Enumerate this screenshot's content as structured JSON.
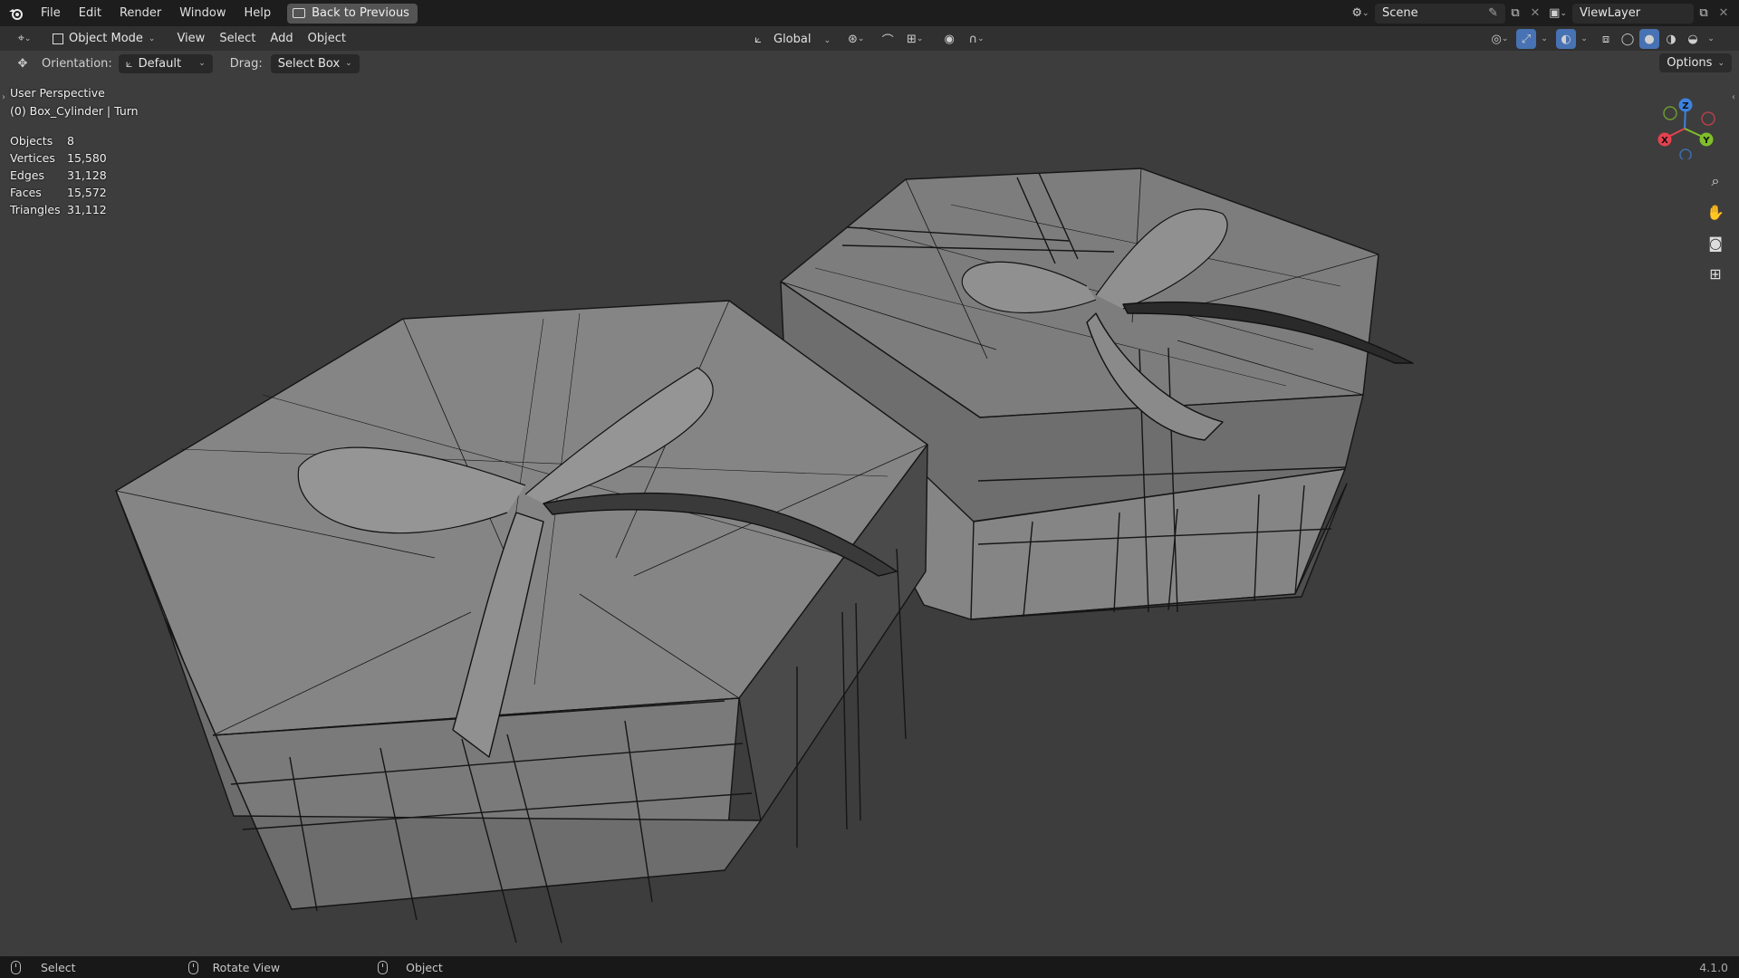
{
  "menubar": {
    "items": [
      "File",
      "Edit",
      "Render",
      "Window",
      "Help"
    ],
    "back_label": "Back to Previous",
    "scene_label": "Scene",
    "viewlayer_label": "ViewLayer"
  },
  "header": {
    "mode": "Object Mode",
    "menus": [
      "View",
      "Select",
      "Add",
      "Object"
    ],
    "transform": "Global",
    "options_label": "Options"
  },
  "tool_settings": {
    "orientation_label": "Orientation:",
    "orientation_value": "Default",
    "drag_label": "Drag:",
    "drag_value": "Select Box"
  },
  "viewport": {
    "perspective": "User Perspective",
    "active_object": "(0) Box_Cylinder | Turn",
    "stats": [
      {
        "label": "Objects",
        "value": "8"
      },
      {
        "label": "Vertices",
        "value": "15,580"
      },
      {
        "label": "Edges",
        "value": "31,128"
      },
      {
        "label": "Faces",
        "value": "15,572"
      },
      {
        "label": "Triangles",
        "value": "31,112"
      }
    ],
    "gizmo": {
      "x": "X",
      "y": "Y",
      "z": "Z"
    }
  },
  "statusbar": {
    "select": "Select",
    "rotate": "Rotate View",
    "object": "Object",
    "version": "4.1.0"
  },
  "colors": {
    "axis_x": "#e5414f",
    "axis_y": "#7fbf2a",
    "axis_z": "#3c82dc",
    "accent": "#4772b3"
  }
}
